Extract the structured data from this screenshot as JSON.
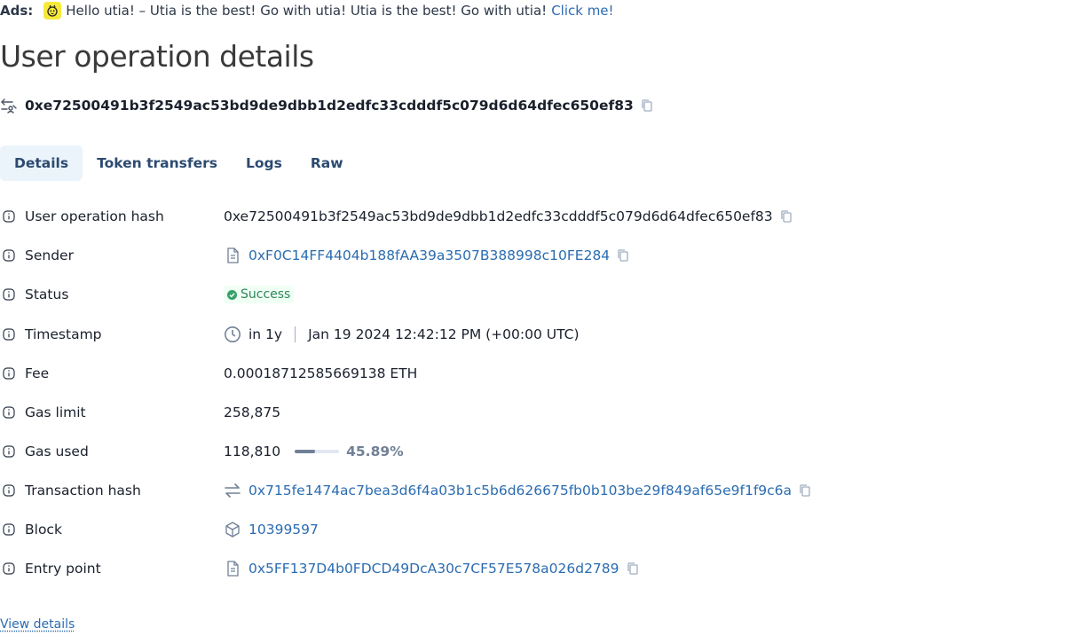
{
  "ads": {
    "label": "Ads:",
    "text": "Hello utia! – Utia is the best! Go with utia! Utia is the best! Go with utia!",
    "link": "Click me!"
  },
  "page": {
    "title": "User operation details"
  },
  "op": {
    "hash": "0xe72500491b3f2549ac53bd9de9dbb1d2edfc33cdddf5c079d6d64dfec650ef83"
  },
  "tabs": [
    {
      "label": "Details",
      "active": true
    },
    {
      "label": "Token transfers"
    },
    {
      "label": "Logs"
    },
    {
      "label": "Raw"
    }
  ],
  "details": {
    "user_op_hash": {
      "label": "User operation hash",
      "value": "0xe72500491b3f2549ac53bd9de9dbb1d2edfc33cdddf5c079d6d64dfec650ef83"
    },
    "sender": {
      "label": "Sender",
      "value": "0xF0C14FF4404b188fAA39a3507B388998c10FE284"
    },
    "status": {
      "label": "Status",
      "value": "Success"
    },
    "timestamp": {
      "label": "Timestamp",
      "relative": "in 1y",
      "absolute": "Jan 19 2024 12:42:12 PM (+00:00 UTC)"
    },
    "fee": {
      "label": "Fee",
      "value": "0.00018712585669138 ETH"
    },
    "gas_limit": {
      "label": "Gas limit",
      "value": "258,875"
    },
    "gas_used": {
      "label": "Gas used",
      "value": "118,810",
      "percent": "45.89%",
      "fraction": 0.4589
    },
    "tx_hash": {
      "label": "Transaction hash",
      "value": "0x715fe1474ac7bea3d6f4a03b1c5b6d626675fb0b103be29f849af65e9f1f9c6a"
    },
    "block": {
      "label": "Block",
      "value": "10399597"
    },
    "entry_point": {
      "label": "Entry point",
      "value": "0x5FF137D4b0FDCD49DcA30c7CF57E578a026d2789"
    }
  },
  "footer": {
    "view_details": "View details"
  },
  "colors": {
    "link": "#2b6cb0",
    "tab_active_bg": "#ebf4fb",
    "success": "#2f855a",
    "success_bg": "#f0fff4"
  }
}
